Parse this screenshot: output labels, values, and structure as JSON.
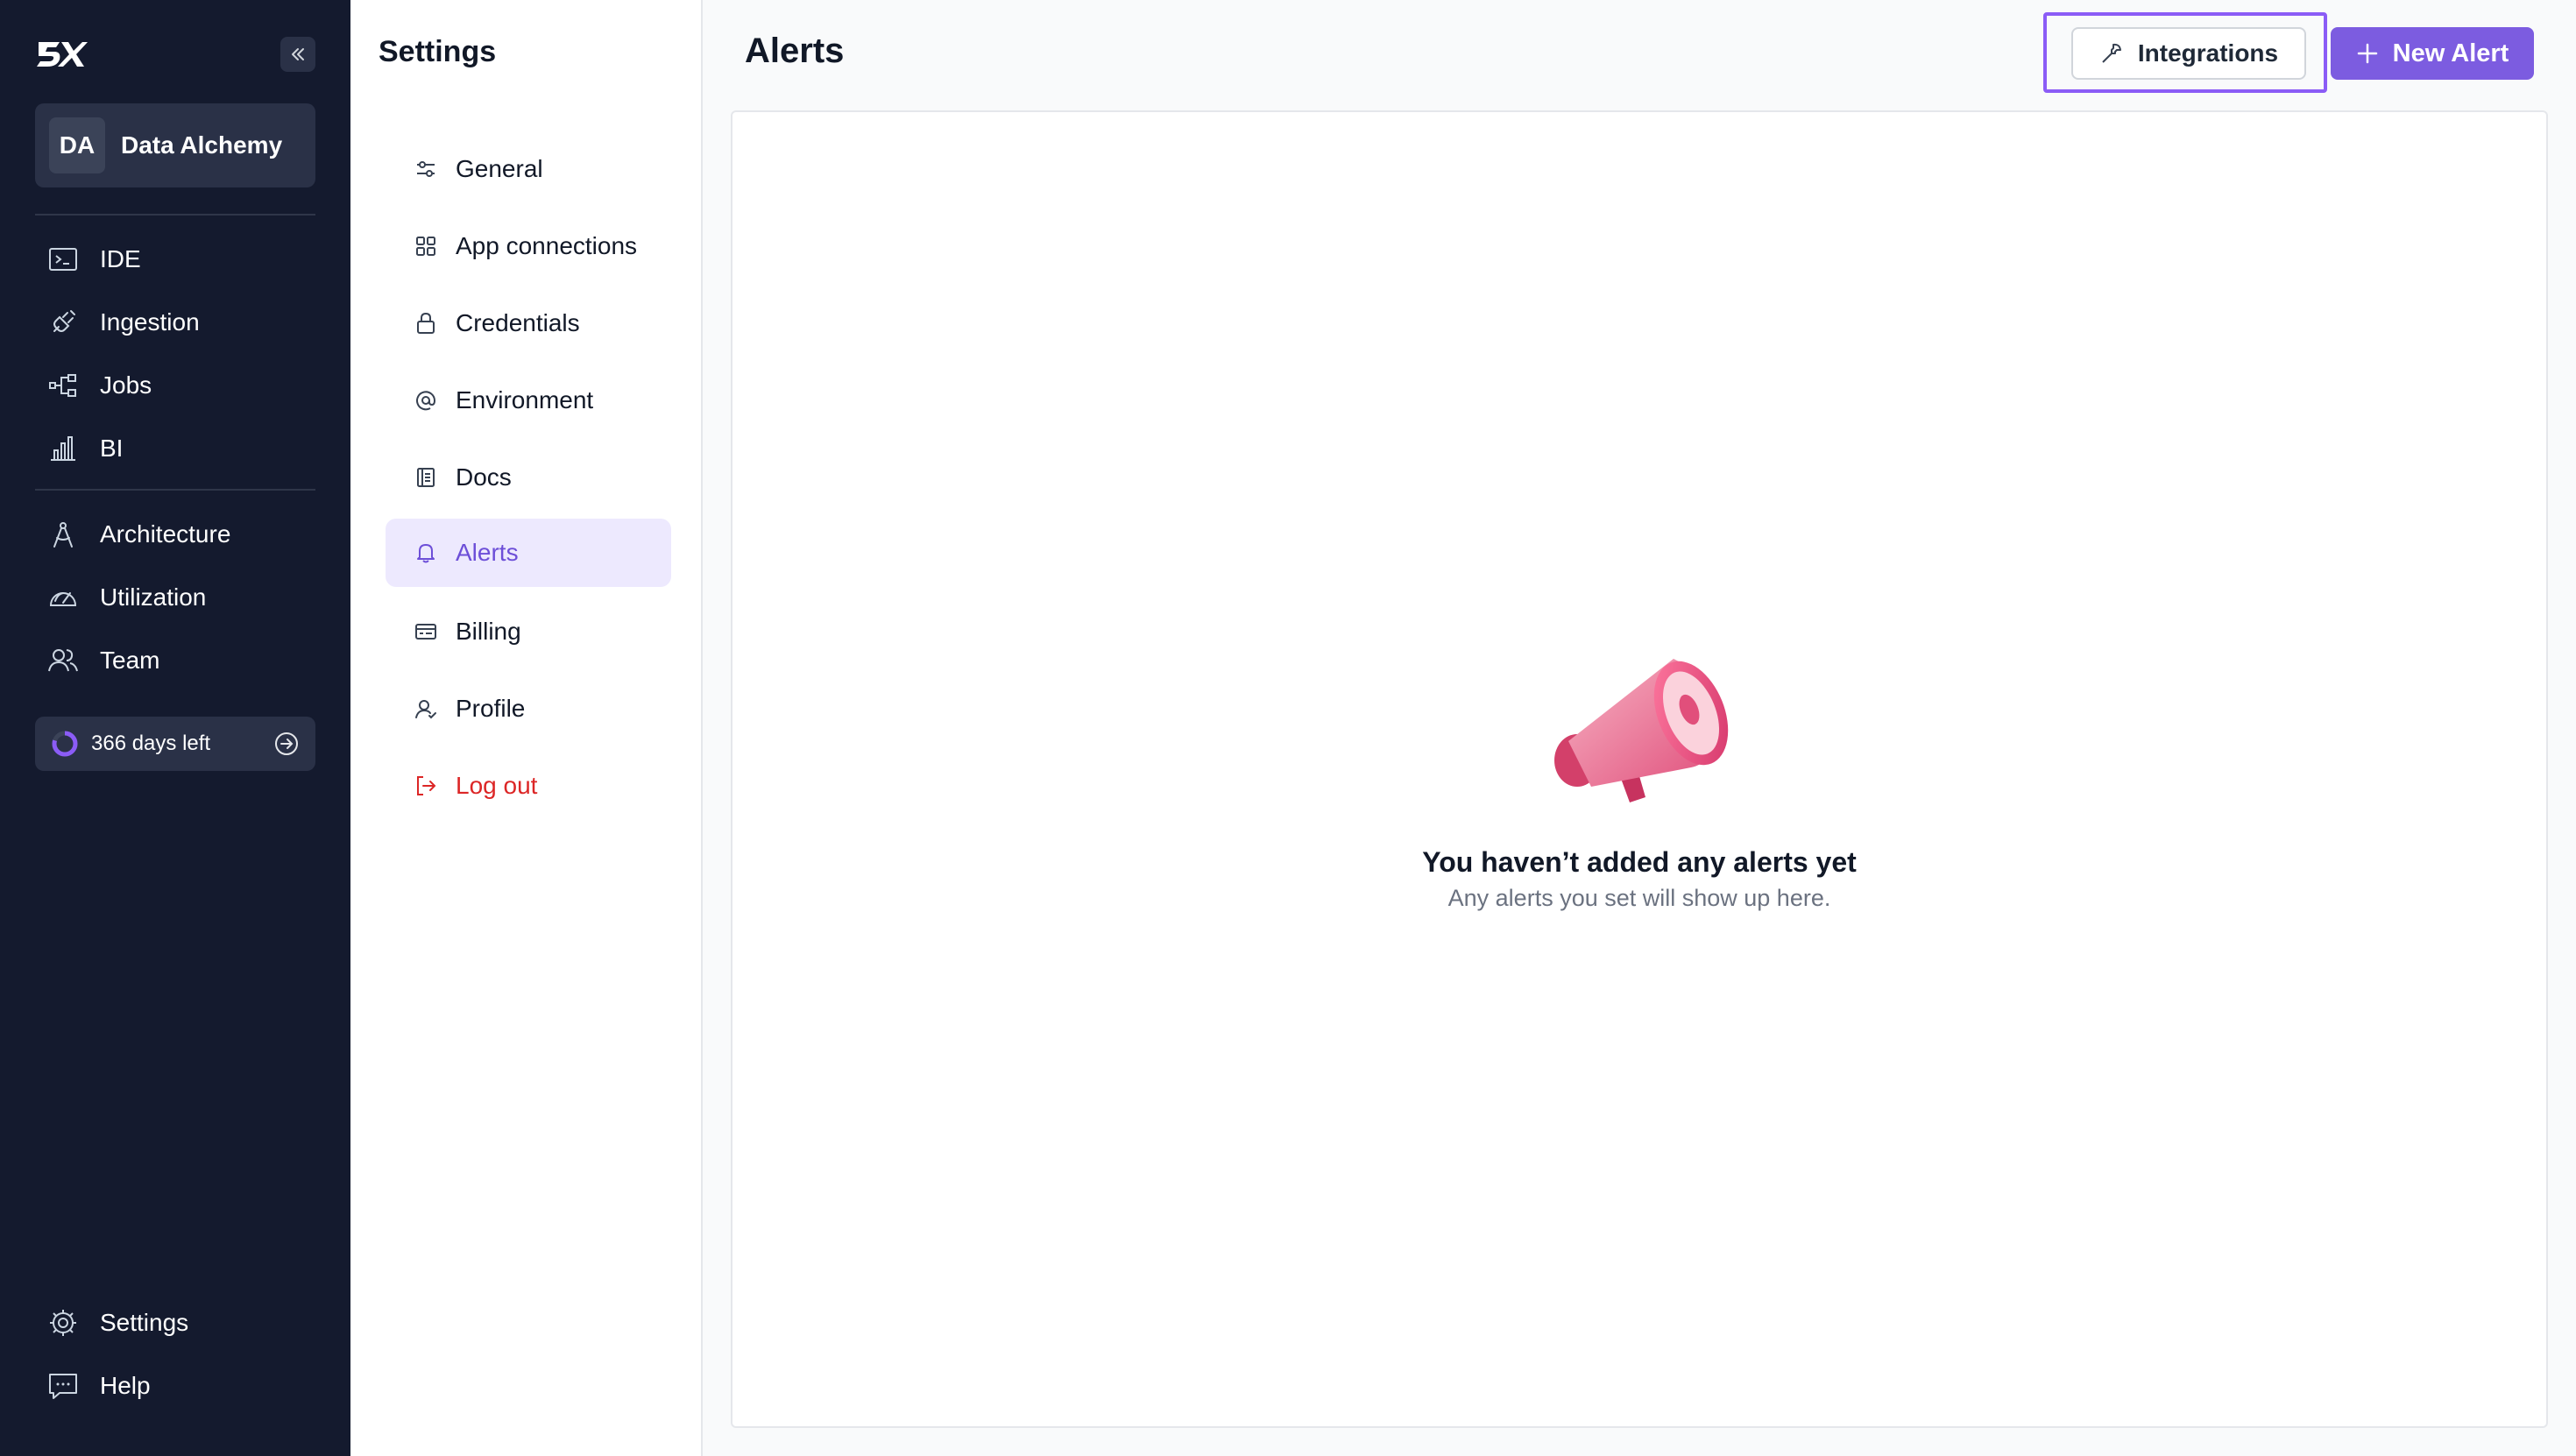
{
  "brand": {
    "logo_text": "5X",
    "icon": "logo-5x"
  },
  "sidebar": {
    "collapse_icon": "chevrons-left-icon",
    "workspace": {
      "initials": "DA",
      "name": "Data Alchemy"
    },
    "primary": [
      {
        "label": "IDE",
        "icon": "terminal-icon"
      },
      {
        "label": "Ingestion",
        "icon": "plug-icon"
      },
      {
        "label": "Jobs",
        "icon": "workflow-icon"
      },
      {
        "label": "BI",
        "icon": "bar-chart-icon"
      }
    ],
    "secondary": [
      {
        "label": "Architecture",
        "icon": "compass-icon"
      },
      {
        "label": "Utilization",
        "icon": "gauge-icon"
      },
      {
        "label": "Team",
        "icon": "users-icon"
      }
    ],
    "trial": {
      "label": "366 days left",
      "icon": "progress-ring-icon"
    },
    "bottom": [
      {
        "label": "Settings",
        "icon": "gear-icon"
      },
      {
        "label": "Help",
        "icon": "chat-icon"
      }
    ]
  },
  "settings": {
    "title": "Settings",
    "items": [
      {
        "label": "General",
        "icon": "sliders-icon"
      },
      {
        "label": "App connections",
        "icon": "grid-icon"
      },
      {
        "label": "Credentials",
        "icon": "lock-icon"
      },
      {
        "label": "Environment",
        "icon": "at-icon"
      },
      {
        "label": "Docs",
        "icon": "doc-icon"
      },
      {
        "label": "Alerts",
        "icon": "bell-icon",
        "active": true
      },
      {
        "label": "Billing",
        "icon": "billing-icon"
      },
      {
        "label": "Profile",
        "icon": "user-icon"
      },
      {
        "label": "Log out",
        "icon": "logout-icon"
      }
    ]
  },
  "main": {
    "title": "Alerts",
    "integrations_label": "Integrations",
    "new_alert_label": "New Alert",
    "empty_title": "You haven’t added any alerts yet",
    "empty_subtitle": "Any alerts you set will show up here."
  },
  "colors": {
    "sidebar_bg": "#141a2e",
    "accent": "#7c5ce0",
    "active_bg": "#ede9fe",
    "danger": "#dc2626",
    "highlight": "#8b5cf6"
  }
}
